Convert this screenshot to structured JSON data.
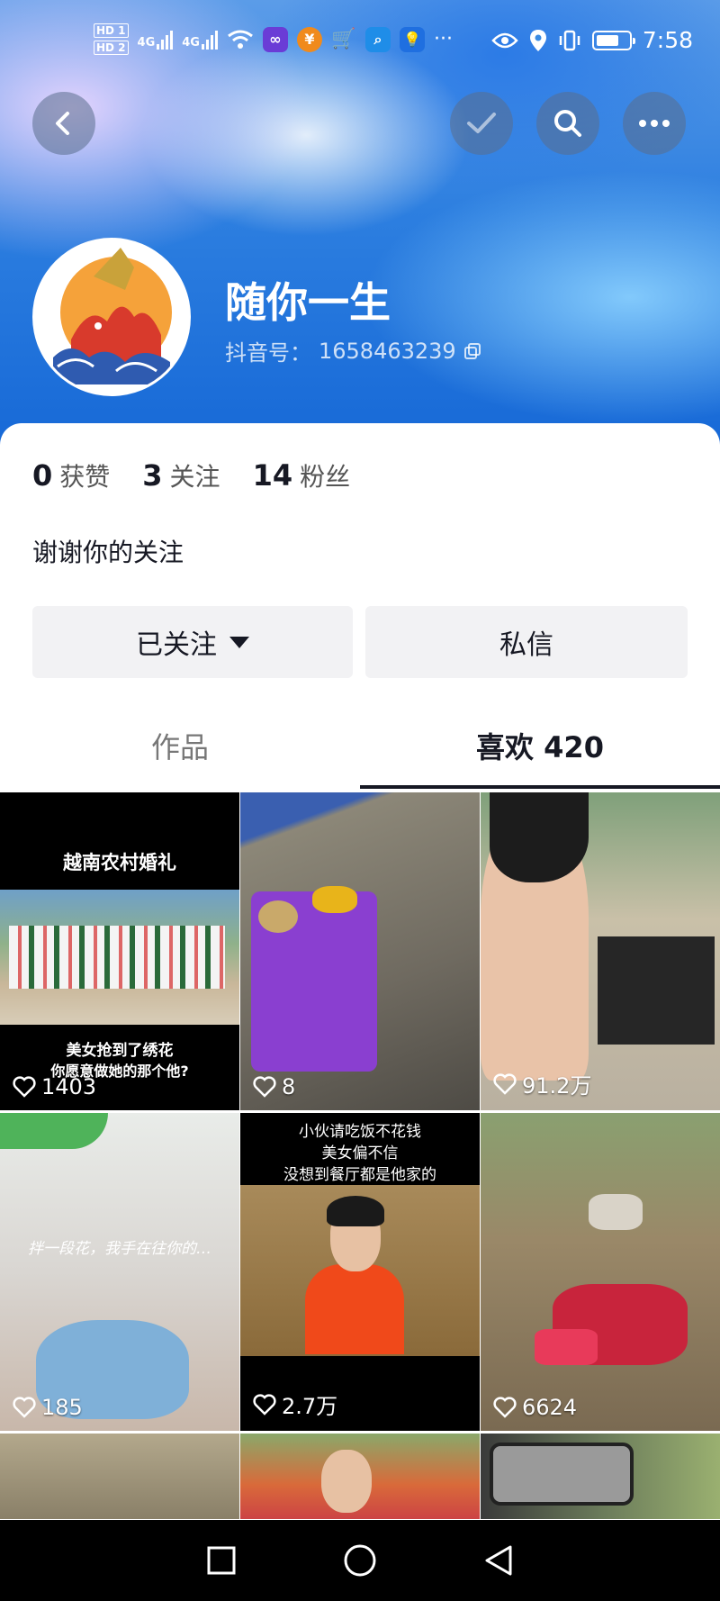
{
  "status_bar": {
    "hd1": "HD 1",
    "hd2": "HD 2",
    "net1": "4G",
    "net2": "4G",
    "time": "7:58",
    "icons": [
      "wifi-icon",
      "infinity-app-icon",
      "coin-app-icon",
      "cart-app-icon",
      "search-app-icon",
      "bulb-app-icon",
      "more-dots-icon",
      "eye-icon",
      "location-icon",
      "vibrate-icon",
      "battery-icon"
    ]
  },
  "header": {
    "nav_icons": [
      "back-icon",
      "check-icon",
      "search-icon",
      "more-icon"
    ]
  },
  "profile": {
    "nickname": "随你一生",
    "douyin_id_label": "抖音号：",
    "douyin_id": "1658463239"
  },
  "stats": [
    {
      "num": "0",
      "label": "获赞"
    },
    {
      "num": "3",
      "label": "关注"
    },
    {
      "num": "14",
      "label": "粉丝"
    }
  ],
  "bio": "谢谢你的关注",
  "buttons": {
    "follow": "已关注",
    "message": "私信"
  },
  "tabs": {
    "works": "作品",
    "likes": "喜欢 420"
  },
  "grid": [
    {
      "top_text": "越南农村婚礼",
      "bottom_text_1": "美女抢到了绣花",
      "bottom_text_2": "你愿意做她的那个他?",
      "likes": "1403"
    },
    {
      "likes": "8"
    },
    {
      "likes": "91.2万"
    },
    {
      "handwriting": "拌一段花，我手在往你的…",
      "likes": "185"
    },
    {
      "top_text_1": "小伙请吃饭不花钱",
      "top_text_2": "美女偏不信",
      "top_text_3": "没想到餐厅都是他家的",
      "likes": "2.7万"
    },
    {
      "likes": "6624"
    },
    {},
    {},
    {}
  ],
  "colors": {
    "header_blue": "#2d7fe0",
    "text_primary": "#161823",
    "button_bg": "#f2f2f4"
  }
}
